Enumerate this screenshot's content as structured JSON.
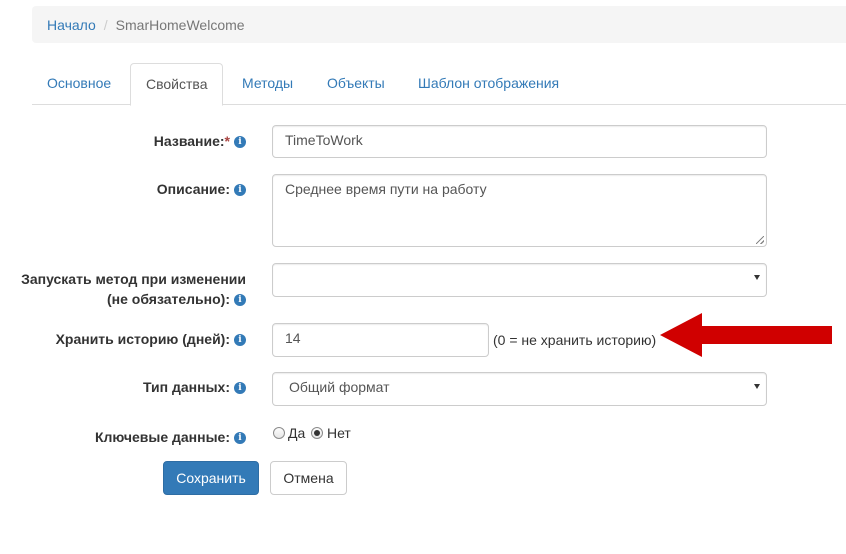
{
  "breadcrumb": {
    "home": "Начало",
    "separator": "/",
    "current": "SmarHomeWelcome"
  },
  "tabs": [
    {
      "label": "Основное",
      "active": false
    },
    {
      "label": "Свойства",
      "active": true
    },
    {
      "label": "Методы",
      "active": false
    },
    {
      "label": "Объекты",
      "active": false
    },
    {
      "label": "Шаблон отображения",
      "active": false
    }
  ],
  "form": {
    "name": {
      "label": "Название:",
      "required_mark": "*",
      "value": "TimeToWork"
    },
    "description": {
      "label": "Описание:",
      "value": "Среднее время пути на работу"
    },
    "method": {
      "label_line1": "Запускать метод при изменении",
      "label_line2": "(не обязательно):",
      "value": ""
    },
    "history": {
      "label": "Хранить историю (дней):",
      "value": "14",
      "hint": "(0 = не хранить историю)"
    },
    "data_type": {
      "label": "Тип данных:",
      "value": "Общий формат"
    },
    "key_data": {
      "label": "Ключевые данные:",
      "options": [
        "Да",
        "Нет"
      ],
      "selected": "Нет"
    }
  },
  "buttons": {
    "save": "Сохранить",
    "cancel": "Отмена"
  },
  "colors": {
    "link": "#337ab7",
    "primary": "#337ab7",
    "required": "#a94442",
    "annotation_arrow": "#d00000"
  },
  "icons": {
    "info": "info-icon",
    "annotation": "red-arrow-icon"
  }
}
